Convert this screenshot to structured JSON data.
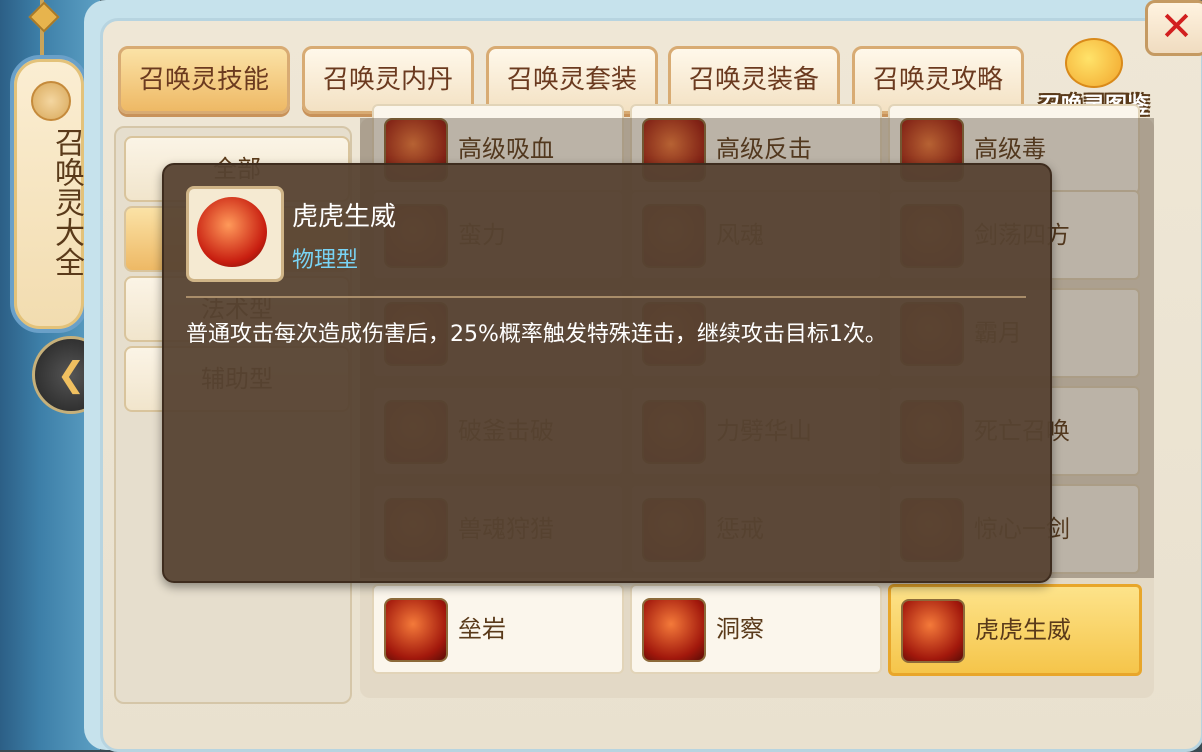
{
  "sidebar": {
    "title": "召唤灵大全",
    "collapse_icon": "chevron-left-icon"
  },
  "close_icon": "close-icon",
  "tabs": [
    {
      "label": "召唤灵技能",
      "active": true
    },
    {
      "label": "召唤灵内丹",
      "active": false
    },
    {
      "label": "召唤灵套装",
      "active": false
    },
    {
      "label": "召唤灵装备",
      "active": false
    },
    {
      "label": "召唤灵攻略",
      "active": false
    }
  ],
  "atlas": {
    "label": "召唤灵图鉴"
  },
  "categories": [
    "全部",
    "物理型",
    "法术型",
    "辅助型"
  ],
  "skills": [
    "高级吸血",
    "高级反击",
    "高级毒",
    "蛮力",
    "风魂",
    "剑荡四方",
    "",
    "",
    "霸月",
    "破釜击破",
    "力劈华山",
    "死亡召唤",
    "兽魂狩猎",
    "惩戒",
    "惊心一剑",
    "垒岩",
    "洞察",
    "虎虎生威"
  ],
  "tooltip": {
    "name": "虎虎生威",
    "type": "物理型",
    "description": "普通攻击每次造成伤害后，25%概率触发特殊连击，继续攻击目标1次。"
  },
  "colors": {
    "selected": "#f5c54a",
    "tooltip_type": "#79d4f5",
    "close": "#d21f1f"
  }
}
